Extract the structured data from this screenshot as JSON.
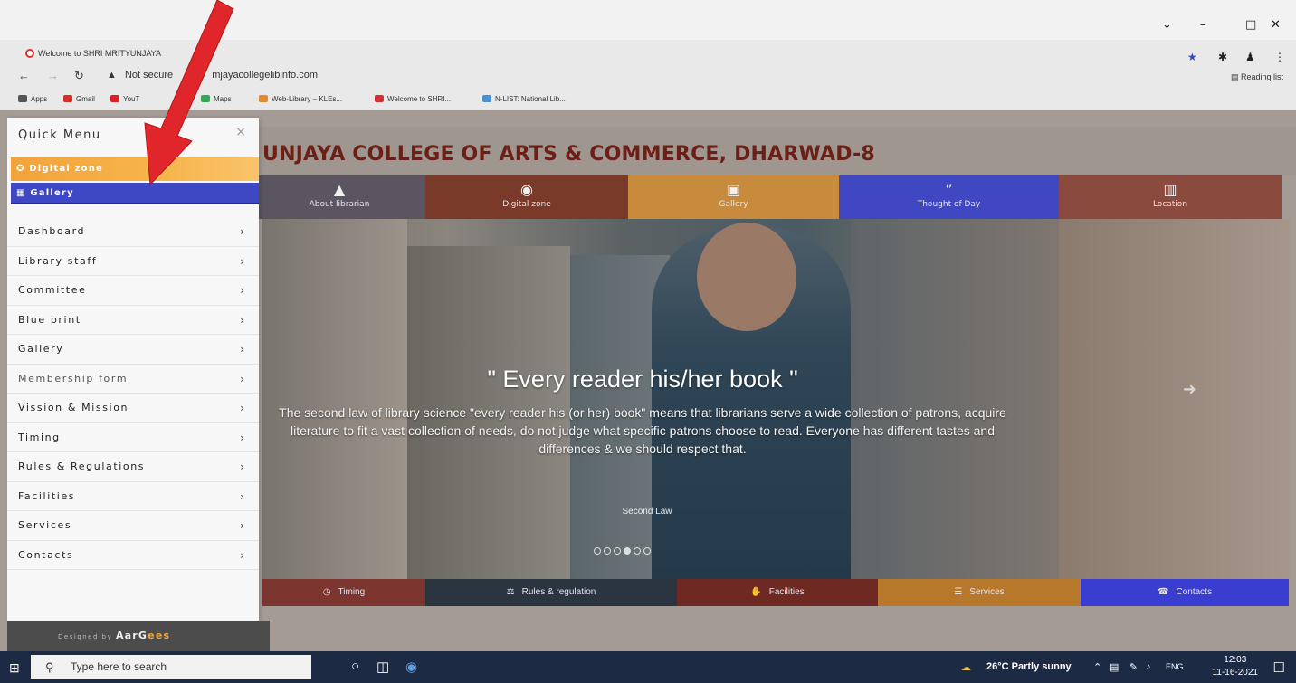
{
  "browser": {
    "tab_title": "Welcome to SHRI MRITYUNJAYA",
    "url_warning": "Not secure",
    "url": "mjayacollegelibinfo.com",
    "reading_list": "Reading list",
    "bookmarks": [
      {
        "label": "Apps",
        "color": "#555555"
      },
      {
        "label": "Gmail",
        "color": "#d93025"
      },
      {
        "label": "YouT",
        "color": "#e02020"
      },
      {
        "label": "Maps",
        "color": "#34a853"
      },
      {
        "label": "Web-Library – KLEs...",
        "color": "#e0892f"
      },
      {
        "label": "Welcome to SHRI...",
        "color": "#d33333"
      },
      {
        "label": "N-LIST: National Lib...",
        "color": "#4a90d9"
      }
    ]
  },
  "site": {
    "title": "UNJAYA COLLEGE OF ARTS & COMMERCE, DHARWAD-8",
    "top_nav": [
      {
        "label": "About librarian",
        "icon": "user-icon",
        "color": "#5a5560"
      },
      {
        "label": "Digital zone",
        "icon": "globe-icon",
        "color": "#7a3a2a"
      },
      {
        "label": "Gallery",
        "icon": "image-icon",
        "color": "#c88b3e"
      },
      {
        "label": "Thought of Day",
        "icon": "quote-icon",
        "color": "#3f48c2"
      },
      {
        "label": "Location",
        "icon": "map-icon",
        "color": "#8a4a3e"
      }
    ],
    "hero": {
      "quote": "\" Every reader his/her book \"",
      "text": "The second law of library science \"every reader his (or her) book\" means that librarians serve a wide collection of patrons, acquire literature to fit a vast collection of needs, do not judge what specific patrons choose to read. Everyone has different tastes and differences & we should respect that.",
      "caption": "Second Law",
      "slides": 6,
      "active_slide": 4
    },
    "bottom_nav": [
      {
        "label": "Timing",
        "icon": "clock-icon",
        "color": "#7d3530"
      },
      {
        "label": "Rules & regulation",
        "icon": "balance-icon",
        "color": "#2a3540"
      },
      {
        "label": "Facilities",
        "icon": "thumb-icon",
        "color": "#6e2a22"
      },
      {
        "label": "Services",
        "icon": "list-icon",
        "color": "#b8782c"
      },
      {
        "label": "Contacts",
        "icon": "phone-icon",
        "color": "#3a3ed0"
      }
    ]
  },
  "sidebar": {
    "title": "Quick Menu",
    "close": "×",
    "digital_zone": "Digital zone",
    "gallery": "Gallery",
    "items": [
      {
        "label": "Dashboard"
      },
      {
        "label": "Library staff"
      },
      {
        "label": "Committee"
      },
      {
        "label": "Blue print"
      },
      {
        "label": "Gallery"
      },
      {
        "label": "Membership form"
      },
      {
        "label": "Vission & Mission"
      },
      {
        "label": "Timing"
      },
      {
        "label": "Rules & Regulations"
      },
      {
        "label": "Facilities"
      },
      {
        "label": "Services"
      },
      {
        "label": "Contacts"
      }
    ],
    "footer_prefix": "Designed by",
    "footer_brand_a": "AarG",
    "footer_brand_b": "ees"
  },
  "taskbar": {
    "search_placeholder": "Type here to search",
    "weather": "26°C  Partly sunny",
    "lang": "ENG",
    "time": "12:03",
    "date": "11-16-2021"
  }
}
